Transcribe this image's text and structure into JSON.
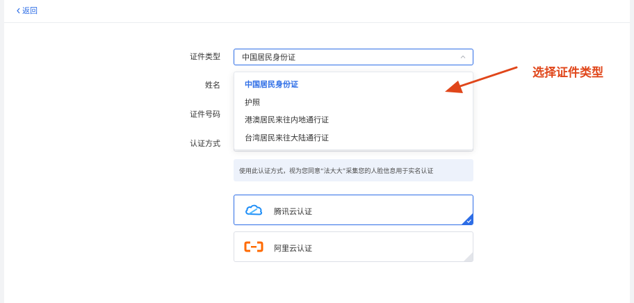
{
  "header": {
    "back_label": "返回"
  },
  "form": {
    "id_type_label": "证件类型",
    "name_label": "姓名",
    "id_number_label": "证件号码",
    "auth_method_label": "认证方式",
    "id_type_value": "中国居民身份证"
  },
  "dropdown": {
    "options": [
      {
        "label": "中国居民身份证",
        "selected": true
      },
      {
        "label": "护照",
        "selected": false
      },
      {
        "label": "港澳居民来往内地通行证",
        "selected": false
      },
      {
        "label": "台湾居民来往大陆通行证",
        "selected": false
      }
    ]
  },
  "notice": {
    "text": "使用此认证方式，视为您同意“法大大”采集您的人脸信息用于实名认证"
  },
  "auth_options": [
    {
      "label": "腾讯云认证",
      "active": true,
      "icon": "tencent-cloud-icon"
    },
    {
      "label": "阿里云认证",
      "active": false,
      "icon": "aliyun-icon"
    }
  ],
  "annotation": {
    "text": "选择证件类型"
  },
  "colors": {
    "accent": "#2d6de6",
    "annotation": "#e0461a",
    "aliyun_orange": "#ff6a00",
    "tencent_blue": "#1f8ef7"
  }
}
